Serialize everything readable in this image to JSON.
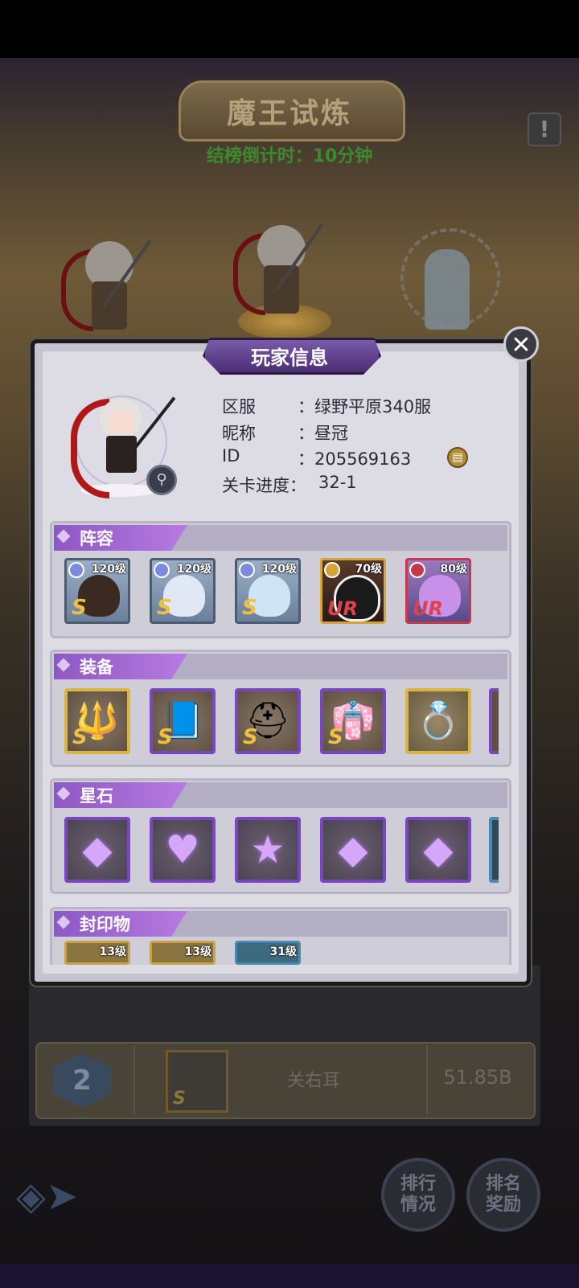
{
  "game": {
    "event_title": "魔王试炼",
    "countdown": "结榜倒计时：10分钟",
    "info_icon": "!"
  },
  "modal": {
    "title": "玩家信息",
    "close_symbol": "✕",
    "player": {
      "server_label": "区服",
      "server_value": "：绿野平原340服",
      "nickname_label": "昵称",
      "nickname_value": "：昼冠",
      "id_label": "ID",
      "id_value": "：205569163",
      "progress_label": "关卡进度：",
      "progress_value": "32-1",
      "copy_icon": "▤",
      "search_icon": "⚲"
    },
    "sections": {
      "lineup": "阵容",
      "equipment": "装备",
      "starstone": "星石",
      "seal": "封印物"
    },
    "heroes": [
      {
        "level": "120级",
        "rank": "S",
        "color": "#f0c040"
      },
      {
        "level": "120级",
        "rank": "S",
        "color": "#f0c040"
      },
      {
        "level": "120级",
        "rank": "S",
        "color": "#f0c040"
      },
      {
        "level": "70级",
        "rank": "UR",
        "color": "#e0404a"
      },
      {
        "level": "80级",
        "rank": "UR",
        "color": "#e0404a"
      }
    ],
    "equipment": [
      {
        "rank": "S",
        "icon": "🔱"
      },
      {
        "rank": "S",
        "icon": "📘"
      },
      {
        "rank": "S",
        "icon": "⛑"
      },
      {
        "rank": "S",
        "icon": "👘"
      },
      {
        "rank": "",
        "icon": "💍"
      }
    ],
    "stones": [
      "◆",
      "♥",
      "★",
      "◆",
      "◆"
    ],
    "seals": [
      {
        "level": "13级"
      },
      {
        "level": "13级"
      },
      {
        "level": "31级"
      }
    ]
  },
  "ranking": {
    "rank_number": "2",
    "avatar_rank": "S",
    "player_name": "关右耳",
    "power": "51.85B"
  },
  "buttons": {
    "ranking": "排行\n情况",
    "ranking_l1": "排行",
    "ranking_l2": "情况",
    "reward_l1": "排名",
    "reward_l2": "奖励",
    "back_icon": "◈➤"
  }
}
